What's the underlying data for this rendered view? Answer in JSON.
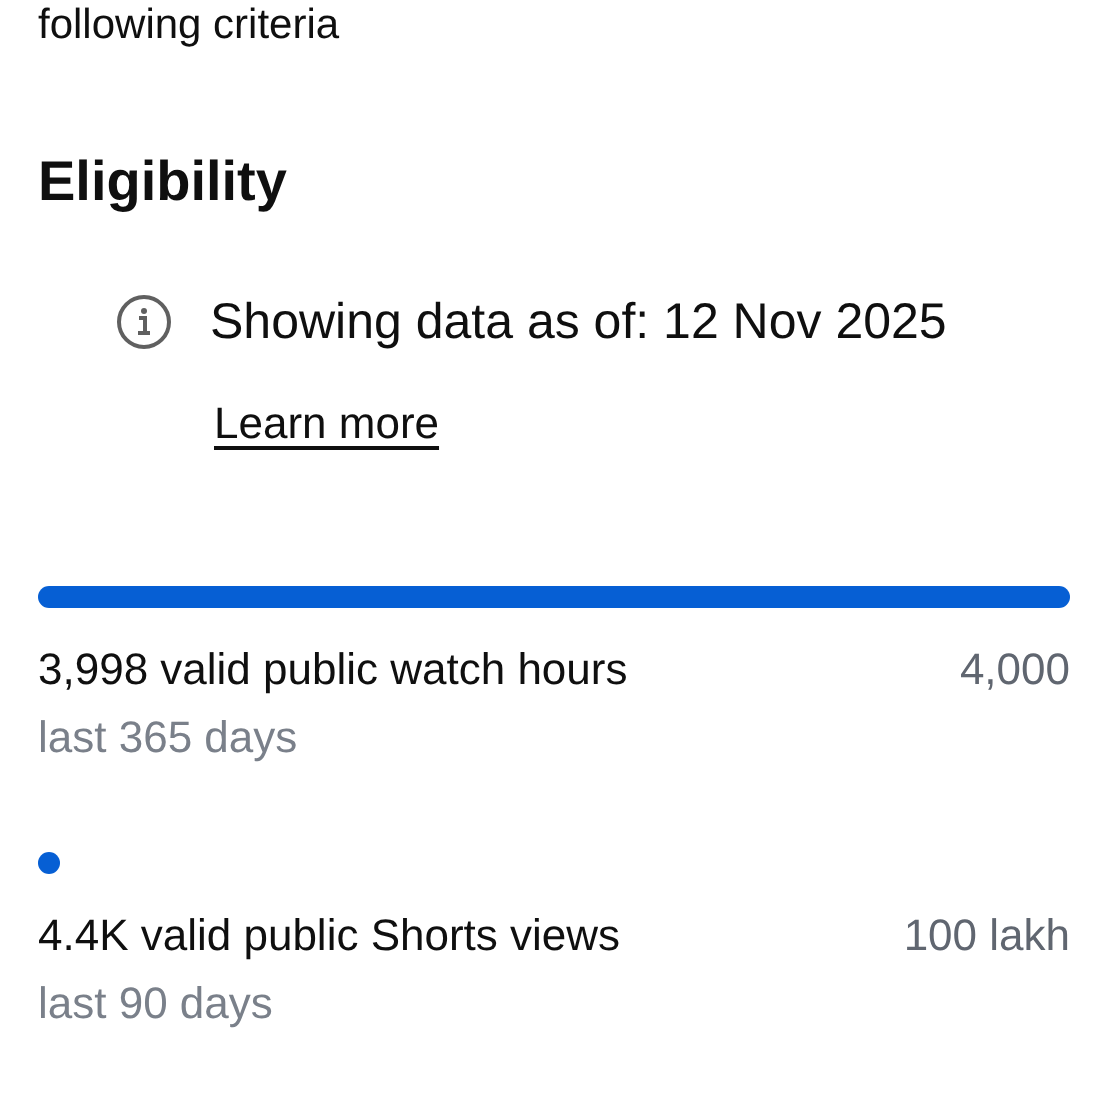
{
  "intro_text": "following criteria",
  "section_title": "Eligibility",
  "info_note": {
    "text": "Showing data as of: 12 Nov 2025",
    "link": "Learn more"
  },
  "metrics": [
    {
      "label": "3,998 valid public watch hours",
      "target": "4,000",
      "period": "last 365 days",
      "level": 0.9995
    },
    {
      "label": "4.4K valid public Shorts views",
      "target": "100 lakh",
      "period": "last 90 days",
      "level": 0.0004
    }
  ]
}
